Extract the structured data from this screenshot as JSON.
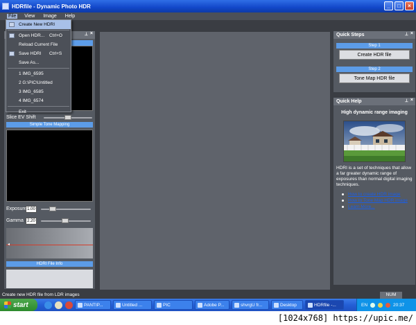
{
  "window": {
    "title": "HDRfile - Dynamic Photo HDR",
    "buttons": [
      "_",
      "□",
      "×"
    ]
  },
  "menubar": [
    "File",
    "View",
    "Image",
    "Help"
  ],
  "file_menu": {
    "items": [
      {
        "label": "Create New HDRI",
        "shortcut": "",
        "icon": "new-document-icon"
      },
      {
        "label": "Open HDR...",
        "shortcut": "Ctrl+O",
        "icon": "folder-icon"
      },
      {
        "label": "Reload Current File",
        "shortcut": ""
      },
      {
        "label": "Save HDRI",
        "shortcut": "Ctrl+S",
        "icon": "save-icon"
      },
      {
        "label": "Save As...",
        "shortcut": ""
      },
      {
        "label": "1 IMG_6595",
        "shortcut": ""
      },
      {
        "label": "2 G:\\PIC\\Untitled",
        "shortcut": ""
      },
      {
        "label": "3 IMG_6585",
        "shortcut": ""
      },
      {
        "label": "4 IMG_6574",
        "shortcut": ""
      },
      {
        "label": "Exit",
        "shortcut": ""
      }
    ]
  },
  "left_panel": {
    "slice_ev_label": "Slice EV Shift",
    "simple_tone_label": "Simple Tone Mapping",
    "exposure_label": "Exposure",
    "exposure_value": "1.00",
    "gamma_label": "Gamma",
    "gamma_value": "2.20",
    "hdri_info_label": "HDRI File Info"
  },
  "quick_steps": {
    "title": "Quick Steps",
    "step1_label": "Step 1",
    "step1_button": "Create HDR file",
    "step2_label": "Step 2",
    "step2_button": "Tone Map HDR file"
  },
  "quick_help": {
    "title": "Quick Help",
    "heading": "High dynamic range imaging",
    "description": "HDRI is a set of techniques that allow a far greater dynamic range of exposures than normal digital imaging techniques.",
    "links": [
      "How to create HDR image",
      "How to Tone Map HDR image",
      "Learn More..."
    ]
  },
  "status": {
    "text": "Create new HDR file from LDR images",
    "num": "NUM"
  },
  "taskbar": {
    "start": "start",
    "tasks": [
      "PANTIP...",
      "Untitled ...",
      "PIC",
      "Adobe P...",
      "shvrgU fr...",
      "Desktop",
      "HDRfile -..."
    ],
    "lang": "EN",
    "clock": "20:37"
  },
  "caption": "[1024x768] https://upic.me/"
}
